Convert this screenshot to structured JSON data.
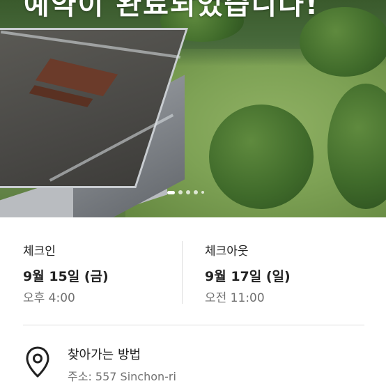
{
  "hero": {
    "headline": "예약이 완료되었습니다!",
    "slide_count": 5,
    "active_slide": 1
  },
  "checkin": {
    "label": "체크인",
    "date": "9월 15일 (금)",
    "time": "오후 4:00"
  },
  "checkout": {
    "label": "체크아웃",
    "date": "9월 17일 (일)",
    "time": "오전 11:00"
  },
  "directions": {
    "title": "찾아가는 방법",
    "address": "주소: 557 Sinchon-ri",
    "icon": "map-pin-icon"
  },
  "colors": {
    "text_primary": "#222222",
    "text_secondary": "#717171",
    "divider": "#dddddd"
  }
}
